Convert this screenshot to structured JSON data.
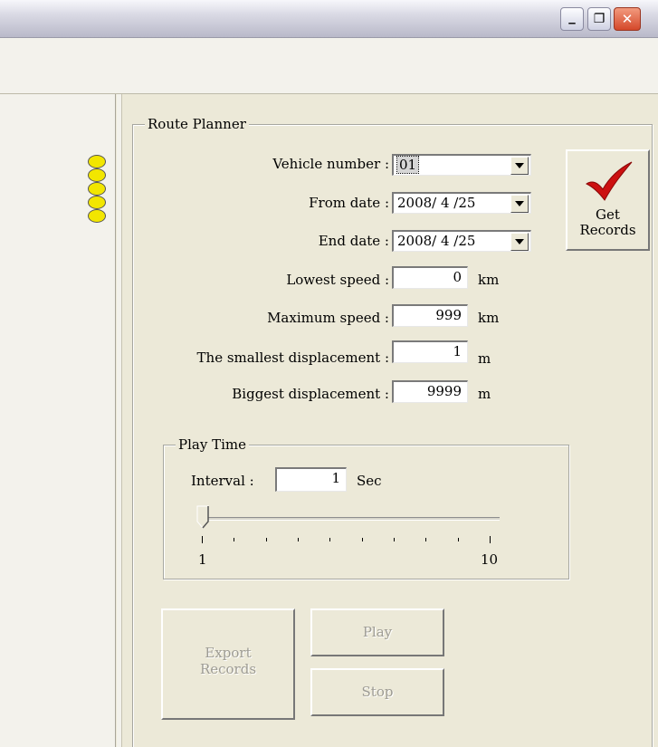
{
  "window": {
    "minimize_glyph": "_",
    "restore_glyph": "❐",
    "close_glyph": "✕"
  },
  "status_indicators": {
    "count": 5,
    "color": "#f2e600"
  },
  "route_planner": {
    "title": "Route Planner",
    "vehicle_number": {
      "label": "Vehicle number :",
      "value": "01"
    },
    "from_date": {
      "label": "From date :",
      "value": "2008/ 4 /25"
    },
    "end_date": {
      "label": "End date :",
      "value": "2008/ 4 /25"
    },
    "lowest_speed": {
      "label": "Lowest speed :",
      "value": "0",
      "unit": "km"
    },
    "maximum_speed": {
      "label": "Maximum speed :",
      "value": "999",
      "unit": "km"
    },
    "smallest_displacement": {
      "label": "The smallest displacement :",
      "value": "1",
      "unit": "m"
    },
    "biggest_displacement": {
      "label": "Biggest displacement :",
      "value": "9999",
      "unit": "m"
    },
    "get_records_button": {
      "line1": "Get",
      "line2": "Records",
      "icon": "checkmark-icon",
      "icon_color": "#cc1111"
    }
  },
  "play_time": {
    "title": "Play Time",
    "interval_label": "Interval :",
    "interval_value": "1",
    "interval_unit": "Sec",
    "slider": {
      "min": 1,
      "max": 10,
      "value": 1,
      "min_label": "1",
      "max_label": "10"
    }
  },
  "actions": {
    "export_line1": "Export",
    "export_line2": "Records",
    "play": "Play",
    "stop": "Stop"
  }
}
